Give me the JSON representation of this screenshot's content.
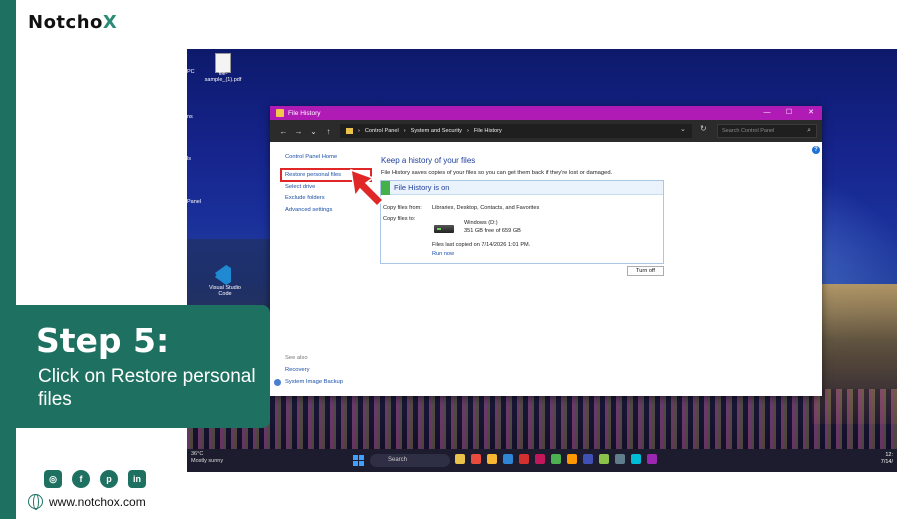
{
  "brand": {
    "logo_main": "Notcho",
    "logo_x": "X",
    "website": "www.notchox.com"
  },
  "step": {
    "title": "Step 5:",
    "subtitle": "Click on Restore personal files"
  },
  "socials": [
    "instagram-icon",
    "facebook-icon",
    "pinterest-icon",
    "linkedin-icon"
  ],
  "desktop": {
    "icons": [
      {
        "label": "file-sample_(1).pdf"
      },
      {
        "label": "Visual Studio Code"
      }
    ],
    "left_labels": [
      "PC",
      "ns",
      "ls",
      "Panel"
    ]
  },
  "taskbar": {
    "weather_temp": "36°C",
    "weather_desc": "Mostly sunny",
    "search_placeholder": "Search",
    "time": "12:",
    "date": "7/14/"
  },
  "window": {
    "title": "File History",
    "controls": [
      "—",
      "☐",
      "✕"
    ],
    "breadcrumb": [
      "Control Panel",
      "System and Security",
      "File History"
    ],
    "search_placeholder": "Search Control Panel",
    "sidebar": {
      "home": "Control Panel Home",
      "restore": "Restore personal files",
      "select_drive": "Select drive",
      "exclude_folders": "Exclude folders",
      "advanced_settings": "Advanced settings",
      "see_also": "See also",
      "recovery": "Recovery",
      "system_image_backup": "System Image Backup"
    },
    "main": {
      "title": "Keep a history of your files",
      "desc": "File History saves copies of your files so you can get them back if they're lost or damaged.",
      "status": "File History is on",
      "copy_from_label": "Copy files from:",
      "copy_from_value": "Libraries, Desktop, Contacts, and Favorites",
      "copy_to_label": "Copy files to:",
      "drive_name": "Windows (D:)",
      "drive_space": "351 GB free of 659 GB",
      "last_copied": "Files last copied on 7/14/2026 1:01 PM.",
      "run_now": "Run now",
      "turn_off": "Turn off"
    }
  },
  "colors": {
    "brand_green": "#1e7161",
    "titlebar": "#b01bb6",
    "highlight": "#e02626"
  }
}
